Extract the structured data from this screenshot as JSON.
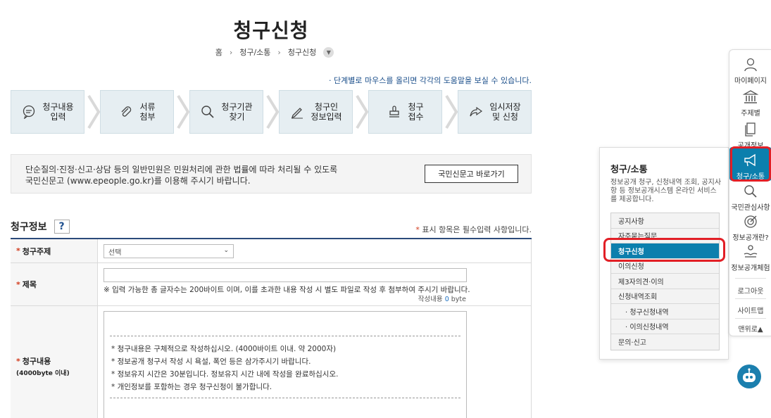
{
  "page": {
    "title": "청구신청",
    "breadcrumb": [
      "홈",
      "청구/소통",
      "청구신청"
    ],
    "help_note": "· 단계별로 마우스를 올리면 각각의 도움말을 보실 수 있습니다."
  },
  "steps": [
    {
      "label": "청구내용\n입력",
      "icon": "chat-bubble-icon"
    },
    {
      "label": "서류\n첨부",
      "icon": "paperclip-icon"
    },
    {
      "label": "청구기관\n찾기",
      "icon": "magnifier-icon"
    },
    {
      "label": "청구인\n정보입력",
      "icon": "pencil-icon"
    },
    {
      "label": "청구\n접수",
      "icon": "stamp-icon"
    },
    {
      "label": "임시저장\n및 신청",
      "icon": "share-arrow-icon"
    }
  ],
  "notice": {
    "line1": "단순질의·진정·신고·상담 등의 일반민원은 민원처리에 관한 법률에 따라 처리될 수 있도록",
    "line2_pre": "국민신문고 (",
    "line2_link": "www.epeople.go.kr",
    "line2_post": ")를 이용해 주시기 바랍니다.",
    "button": "국민신문고 바로가기"
  },
  "form": {
    "section_title": "청구정보",
    "help_mark": "?",
    "required_note": "표시 항목은 필수입력 사항입니다.",
    "required_star": "*",
    "subject": {
      "label": "청구주제",
      "value": "선택"
    },
    "title": {
      "label": "제목",
      "note": "※ 입력 가능한 총 글자수는 200바이트 이며, 이를 초과한 내용 작성 시 별도 파일로 작성 후 첨부하여 주시기 바랍니다.",
      "count_label": "작성내용",
      "count_value": "0",
      "count_unit": "byte"
    },
    "content": {
      "label": "청구내용",
      "sub_label": "(4000byte 이내)",
      "lines": [
        "* 청구내용은 구체적으로 작성하십시오. (4000바이트 이내. 약 2000자)",
        "* 정보공개 청구서 작성 시 욕설, 폭언 등은 삼가주시기 바랍니다.",
        "* 정보유지 시간은 30분입니다. 정보유지 시간 내에 작성을 완료하십시오.",
        "* 개인정보를 포함하는 경우 청구신청이 불가합니다."
      ]
    }
  },
  "flyout": {
    "title": "청구/소통",
    "desc": "정보공개 청구, 신청내역 조회, 공지사항 등 정보공개시스템 온라인 서비스를 제공합니다.",
    "items": [
      {
        "label": "공지사항",
        "sub": false,
        "active": false
      },
      {
        "label": "자주묻는질문",
        "sub": false,
        "active": false
      },
      {
        "label": "청구신청",
        "sub": false,
        "active": true
      },
      {
        "label": "이의신청",
        "sub": false,
        "active": false
      },
      {
        "label": "제3자의견·이의",
        "sub": false,
        "active": false
      },
      {
        "label": "신청내역조회",
        "sub": false,
        "active": false
      },
      {
        "label": "· 청구신청내역",
        "sub": true,
        "active": false
      },
      {
        "label": "· 이의신청내역",
        "sub": true,
        "active": false
      },
      {
        "label": "문의·신고",
        "sub": false,
        "active": false
      }
    ]
  },
  "quickbar": {
    "items": [
      {
        "label": "마이페이지",
        "icon": "person-icon"
      },
      {
        "label": "주제별",
        "icon": "building-icon"
      },
      {
        "label": "공개정보",
        "icon": "document-icon"
      },
      {
        "label": "청구/소통",
        "icon": "megaphone-icon"
      },
      {
        "label": "국민관심사항",
        "icon": "search-icon"
      },
      {
        "label": "정보공개란?",
        "icon": "target-icon"
      },
      {
        "label": "정보공개체험",
        "icon": "hands-icon"
      }
    ],
    "links": [
      "로그아웃",
      "사이트맵",
      "맨위로▲"
    ]
  },
  "colors": {
    "accent": "#0c7fad",
    "highlight": "#e21f26",
    "navy": "#2b4a7a"
  }
}
